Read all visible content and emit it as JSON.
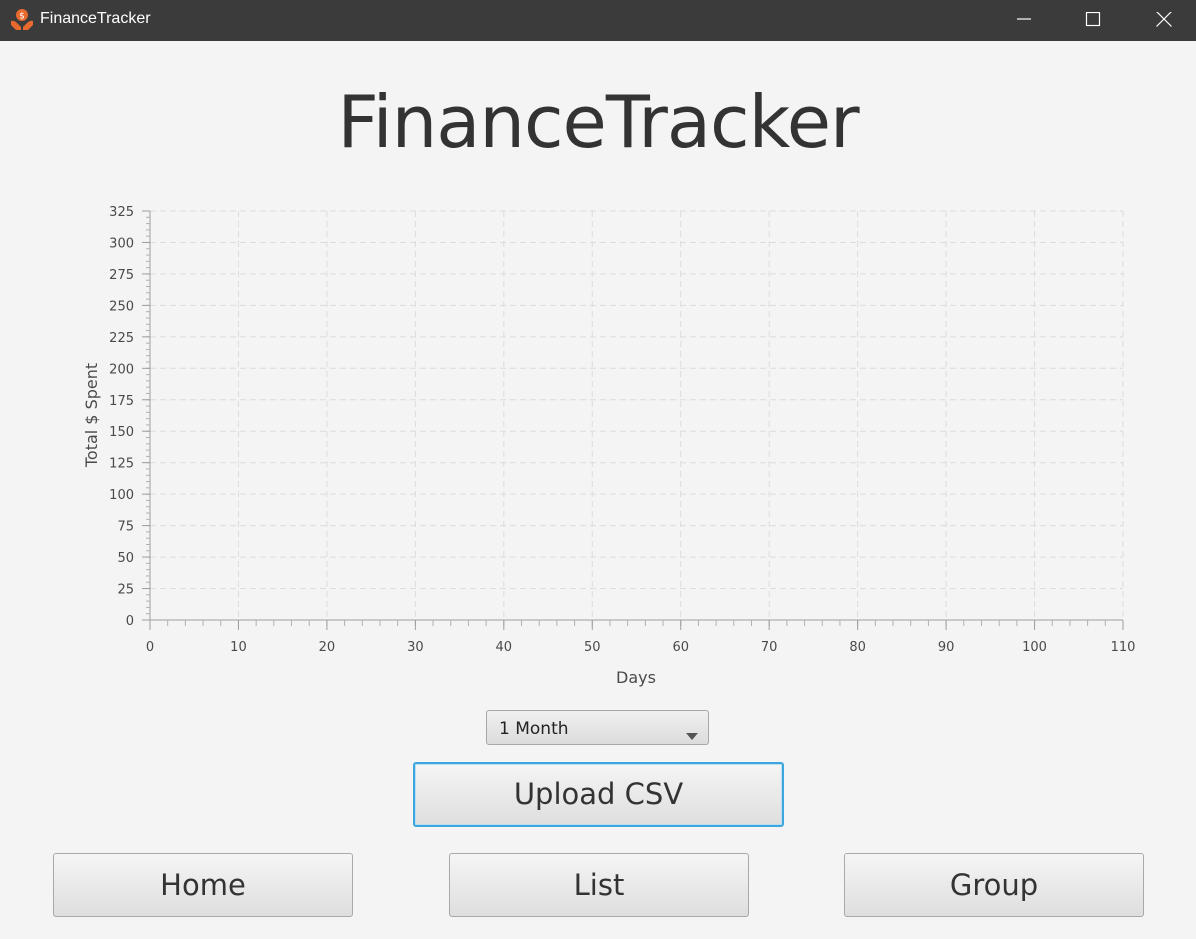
{
  "window": {
    "title": "FinanceTracker",
    "icon": "hands-holding-coin-icon",
    "controls": [
      "minimize-icon",
      "maximize-icon",
      "close-icon"
    ]
  },
  "heading": "FinanceTracker",
  "chart_data": {
    "type": "line",
    "title": "",
    "xlabel": "Days",
    "ylabel": "Total $ Spent",
    "xlim": [
      0,
      110
    ],
    "ylim": [
      0,
      325
    ],
    "x_ticks": [
      0,
      10,
      20,
      30,
      40,
      50,
      60,
      70,
      80,
      90,
      100,
      110
    ],
    "y_ticks": [
      0,
      25,
      50,
      75,
      100,
      125,
      150,
      175,
      200,
      225,
      250,
      275,
      300,
      325
    ],
    "series": [],
    "grid": true,
    "legend": "none"
  },
  "period_select": {
    "selected": "1 Month"
  },
  "buttons": {
    "upload": "Upload CSV",
    "home": "Home",
    "list": "List",
    "group": "Group"
  },
  "colors": {
    "titlebar": "#3b3b3b",
    "background": "#f4f4f4",
    "focus": "#3da6de",
    "icon": "#e8692e"
  }
}
